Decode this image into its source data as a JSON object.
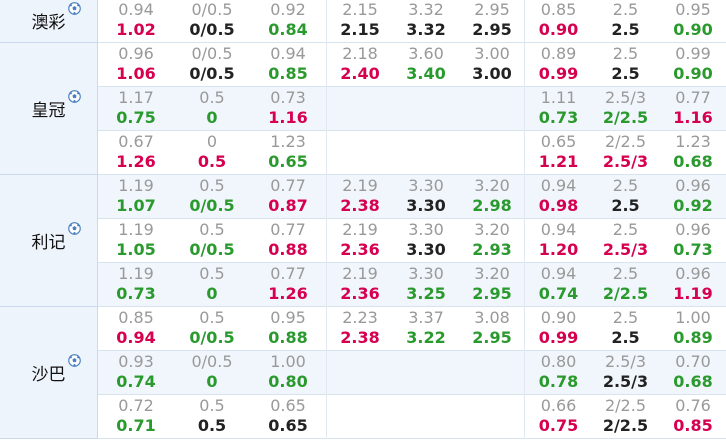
{
  "companies": [
    {
      "name": "澳彩",
      "rows": [
        {
          "alt": false,
          "g1": [
            [
              "0.94",
              "1.02",
              "red"
            ],
            [
              "0/0.5",
              "0/0.5",
              "black"
            ],
            [
              "0.92",
              "0.84",
              "green"
            ]
          ],
          "g2": [
            [
              "2.15",
              "2.15",
              "black"
            ],
            [
              "3.32",
              "3.32",
              "black"
            ],
            [
              "2.95",
              "2.95",
              "black"
            ]
          ],
          "g3": [
            [
              "0.85",
              "0.90",
              "red"
            ],
            [
              "2.5",
              "2.5",
              "black"
            ],
            [
              "0.95",
              "0.90",
              "green"
            ]
          ]
        }
      ]
    },
    {
      "name": "皇冠",
      "rows": [
        {
          "alt": false,
          "g1": [
            [
              "0.96",
              "1.06",
              "red"
            ],
            [
              "0/0.5",
              "0/0.5",
              "black"
            ],
            [
              "0.94",
              "0.85",
              "green"
            ]
          ],
          "g2": [
            [
              "2.18",
              "2.40",
              "red"
            ],
            [
              "3.60",
              "3.40",
              "green"
            ],
            [
              "3.00",
              "3.00",
              "black"
            ]
          ],
          "g3": [
            [
              "0.89",
              "0.99",
              "red"
            ],
            [
              "2.5",
              "2.5",
              "black"
            ],
            [
              "0.99",
              "0.90",
              "green"
            ]
          ]
        },
        {
          "alt": true,
          "g1": [
            [
              "1.17",
              "0.75",
              "green"
            ],
            [
              "0.5",
              "0",
              "green"
            ],
            [
              "0.73",
              "1.16",
              "red"
            ]
          ],
          "g2": [],
          "g3": [
            [
              "1.11",
              "0.73",
              "green"
            ],
            [
              "2.5/3",
              "2/2.5",
              "green"
            ],
            [
              "0.77",
              "1.16",
              "red"
            ]
          ]
        },
        {
          "alt": false,
          "g1": [
            [
              "0.67",
              "1.26",
              "red"
            ],
            [
              "0",
              "0.5",
              "red"
            ],
            [
              "1.23",
              "0.65",
              "green"
            ]
          ],
          "g2": [],
          "g3": [
            [
              "0.65",
              "1.21",
              "red"
            ],
            [
              "2/2.5",
              "2.5/3",
              "red"
            ],
            [
              "1.23",
              "0.68",
              "green"
            ]
          ]
        }
      ]
    },
    {
      "name": "利记",
      "rows": [
        {
          "alt": true,
          "g1": [
            [
              "1.19",
              "1.07",
              "green"
            ],
            [
              "0.5",
              "0/0.5",
              "green"
            ],
            [
              "0.77",
              "0.87",
              "red"
            ]
          ],
          "g2": [
            [
              "2.19",
              "2.38",
              "red"
            ],
            [
              "3.30",
              "3.30",
              "black"
            ],
            [
              "3.20",
              "2.98",
              "green"
            ]
          ],
          "g3": [
            [
              "0.94",
              "0.98",
              "red"
            ],
            [
              "2.5",
              "2.5",
              "black"
            ],
            [
              "0.96",
              "0.92",
              "green"
            ]
          ]
        },
        {
          "alt": false,
          "g1": [
            [
              "1.19",
              "1.05",
              "green"
            ],
            [
              "0.5",
              "0/0.5",
              "green"
            ],
            [
              "0.77",
              "0.88",
              "red"
            ]
          ],
          "g2": [
            [
              "2.19",
              "2.36",
              "red"
            ],
            [
              "3.30",
              "3.30",
              "black"
            ],
            [
              "3.20",
              "2.93",
              "green"
            ]
          ],
          "g3": [
            [
              "0.94",
              "1.20",
              "red"
            ],
            [
              "2.5",
              "2.5/3",
              "red"
            ],
            [
              "0.96",
              "0.73",
              "green"
            ]
          ]
        },
        {
          "alt": true,
          "g1": [
            [
              "1.19",
              "0.73",
              "green"
            ],
            [
              "0.5",
              "0",
              "green"
            ],
            [
              "0.77",
              "1.26",
              "red"
            ]
          ],
          "g2": [
            [
              "2.19",
              "2.36",
              "red"
            ],
            [
              "3.30",
              "3.25",
              "green"
            ],
            [
              "3.20",
              "2.95",
              "green"
            ]
          ],
          "g3": [
            [
              "0.94",
              "0.74",
              "green"
            ],
            [
              "2.5",
              "2/2.5",
              "green"
            ],
            [
              "0.96",
              "1.19",
              "red"
            ]
          ]
        }
      ]
    },
    {
      "name": "沙巴",
      "rows": [
        {
          "alt": false,
          "g1": [
            [
              "0.85",
              "0.94",
              "red"
            ],
            [
              "0.5",
              "0/0.5",
              "green"
            ],
            [
              "0.95",
              "0.88",
              "green"
            ]
          ],
          "g2": [
            [
              "2.23",
              "2.38",
              "red"
            ],
            [
              "3.37",
              "3.22",
              "green"
            ],
            [
              "3.08",
              "2.95",
              "green"
            ]
          ],
          "g3": [
            [
              "0.90",
              "0.99",
              "red"
            ],
            [
              "2.5",
              "2.5",
              "black"
            ],
            [
              "1.00",
              "0.89",
              "green"
            ]
          ]
        },
        {
          "alt": true,
          "g1": [
            [
              "0.93",
              "0.74",
              "green"
            ],
            [
              "0/0.5",
              "0",
              "green"
            ],
            [
              "1.00",
              "0.80",
              "green"
            ]
          ],
          "g2": [],
          "g3": [
            [
              "0.80",
              "0.78",
              "green"
            ],
            [
              "2.5/3",
              "2.5/3",
              "black"
            ],
            [
              "0.70",
              "0.68",
              "green"
            ]
          ]
        },
        {
          "alt": false,
          "g1": [
            [
              "0.72",
              "0.71",
              "green"
            ],
            [
              "0.5",
              "0.5",
              "black"
            ],
            [
              "0.65",
              "0.65",
              "black"
            ]
          ],
          "g2": [],
          "g3": [
            [
              "0.66",
              "0.75",
              "red"
            ],
            [
              "2/2.5",
              "2/2.5",
              "black"
            ],
            [
              "0.76",
              "0.85",
              "red"
            ]
          ]
        }
      ]
    }
  ],
  "colors": {
    "red": "#d6004f",
    "green": "#2b9a2e",
    "black": "#222222",
    "initial": "#999999"
  }
}
